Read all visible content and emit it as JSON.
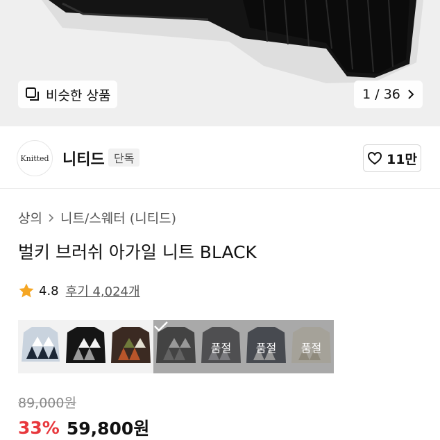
{
  "hero": {
    "similar_label": "비슷한 상품",
    "counter": "1 / 36"
  },
  "brand": {
    "logo_text": "Knitted",
    "name": "니티드",
    "badge": "단독",
    "likes": "11만"
  },
  "breadcrumb": {
    "items": [
      "상의",
      "니트/스웨터 (니티드)"
    ]
  },
  "product": {
    "title": "벌키 브러쉬 아가일 니트 BLACK",
    "rating": "4.8",
    "reviews": "후기 4,024개"
  },
  "swatches": [
    {
      "name": "color-option-1",
      "status": ""
    },
    {
      "name": "color-option-2",
      "status": ""
    },
    {
      "name": "color-option-3",
      "status": ""
    },
    {
      "name": "color-option-4-selected",
      "status": ""
    },
    {
      "name": "color-option-5",
      "status": "품절"
    },
    {
      "name": "color-option-6",
      "status": "품절"
    },
    {
      "name": "color-option-7",
      "status": "품절"
    }
  ],
  "price": {
    "original": "89,000원",
    "discount": "33%",
    "sale": "59,800원"
  },
  "colors": {
    "accent_red": "#e8383d",
    "star": "#f5a623"
  }
}
